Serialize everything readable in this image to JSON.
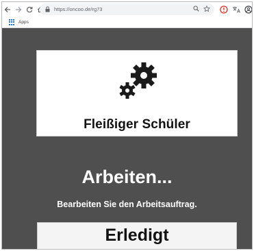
{
  "browser": {
    "url_protocol": "https://",
    "url_host": "oncoo.de/rg73",
    "bookmarks_apps_label": "Apps"
  },
  "icons": {
    "back": "arrow-left-icon",
    "forward": "arrow-right-icon",
    "reload": "reload-icon",
    "home": "home-icon",
    "lock": "lock-icon",
    "zoom": "magnifier-icon",
    "star": "star-icon",
    "gears": "gears-icon"
  },
  "page": {
    "card_title": "Fleißiger Schüler",
    "status_title": "Arbeiten...",
    "status_text": "Bearbeiten Sie den Arbeitsauftrag.",
    "done_button_label": "Erledigt"
  },
  "colors": {
    "page_background": "#4f4f4f",
    "card_background": "#ffffff",
    "button_background": "#f4f4f4"
  }
}
